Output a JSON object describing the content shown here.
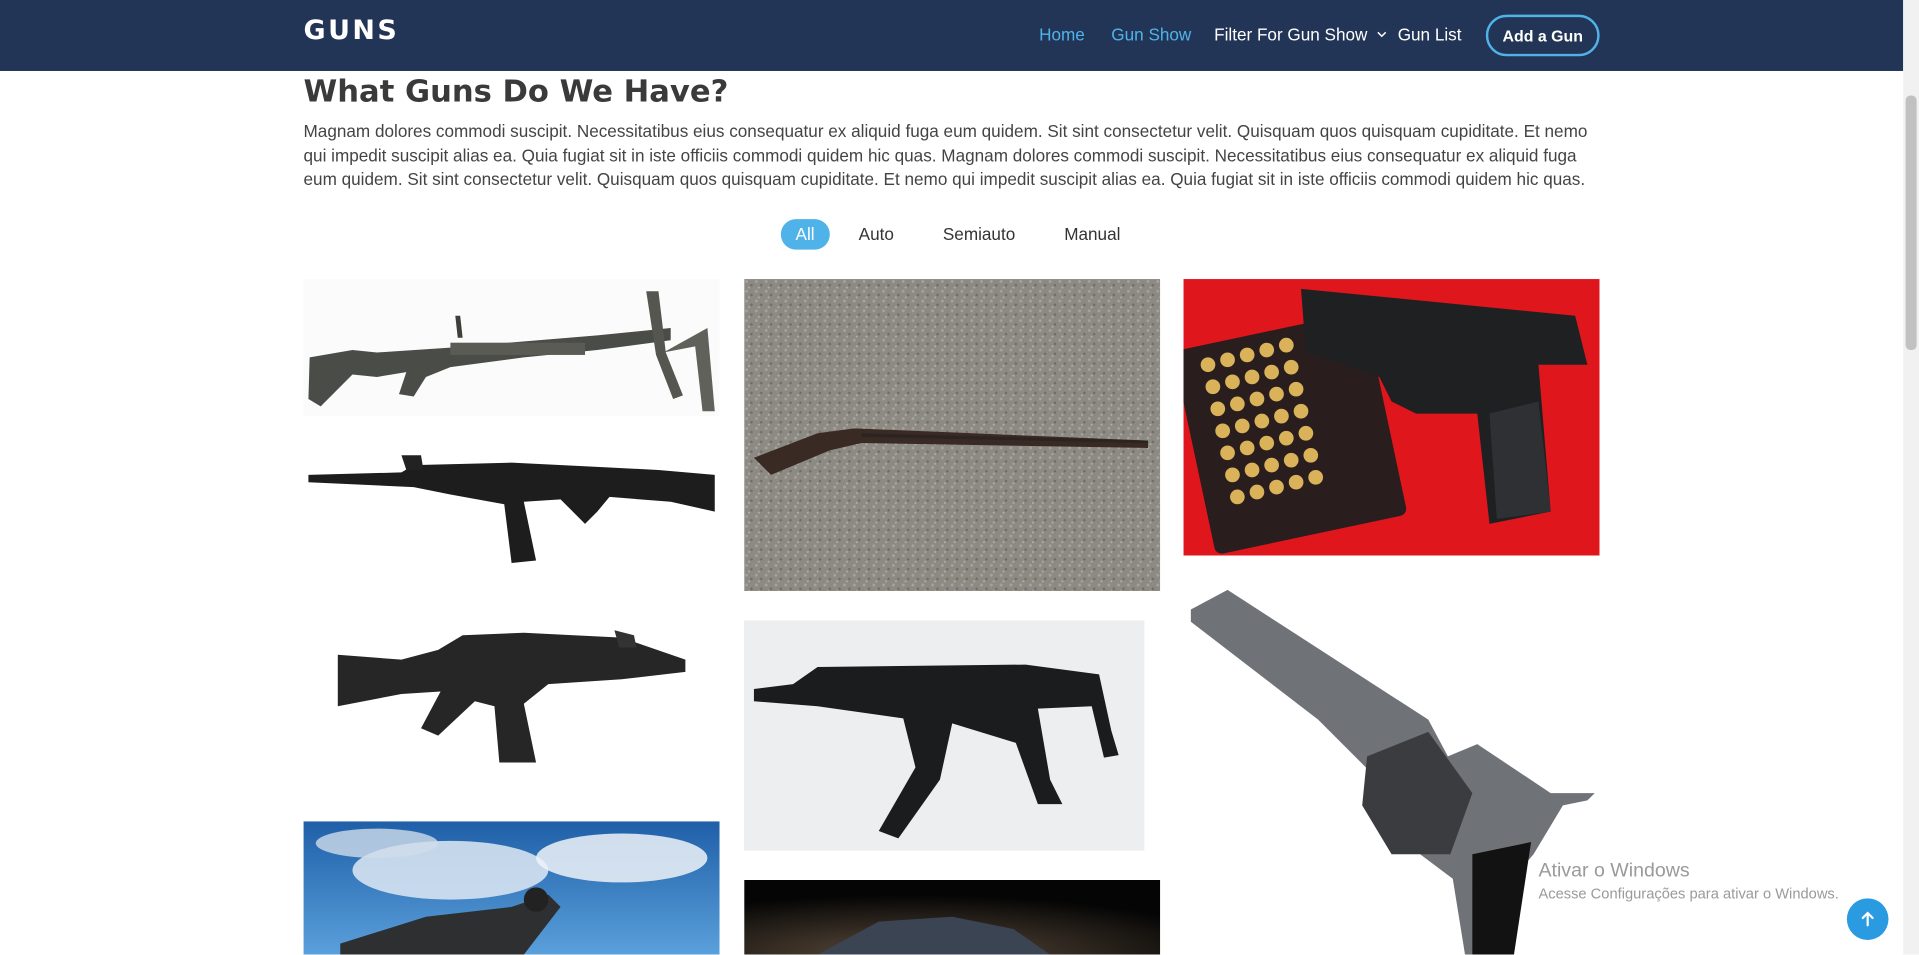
{
  "header": {
    "logo": "GUNS",
    "nav": [
      {
        "label": "Home",
        "active": true
      },
      {
        "label": "Gun Show",
        "active": true
      },
      {
        "label": "Filter For Gun Show",
        "active": false
      },
      {
        "label": "Gun List",
        "active": false
      }
    ],
    "cta_label": "Add a Gun"
  },
  "main": {
    "title": "What Guns Do We Have?",
    "intro": "Magnam dolores commodi suscipit. Necessitatibus eius consequatur ex aliquid fuga eum quidem. Sit sint consectetur velit. Quisquam quos quisquam cupiditate. Et nemo qui impedit suscipit alias ea. Quia fugiat sit in iste officiis commodi quidem hic quas. Magnam dolores commodi suscipit. Necessitatibus eius consequatur ex aliquid fuga eum quidem. Sit sint consectetur velit. Quisquam quos quisquam cupiditate. Et nemo qui impedit suscipit alias ea. Quia fugiat sit in iste officiis commodi quidem hic quas.",
    "filters": [
      {
        "label": "All",
        "active": true
      },
      {
        "label": "Auto",
        "active": false
      },
      {
        "label": "Semiauto",
        "active": false
      },
      {
        "label": "Manual",
        "active": false
      }
    ],
    "gallery": [
      {
        "name": "machine-gun-image"
      },
      {
        "name": "musket-image"
      },
      {
        "name": "pistol-with-ammo-image"
      },
      {
        "name": "assault-rifle-image"
      },
      {
        "name": "carbine-image"
      },
      {
        "name": "submachine-gun-image"
      },
      {
        "name": "revolver-image"
      },
      {
        "name": "rifle-sky-image"
      },
      {
        "name": "dark-gun-image"
      }
    ]
  },
  "os_overlay": {
    "activate_title": "Ativar o Windows",
    "activate_subtitle": "Acesse Configurações para ativar o Windows."
  },
  "icons": {
    "dropdown": "chevron-down-icon",
    "back_to_top": "arrow-up-icon"
  },
  "colors": {
    "navbar": "#233556",
    "accent": "#4fb3e9",
    "back_to_top": "#2a9be0"
  }
}
